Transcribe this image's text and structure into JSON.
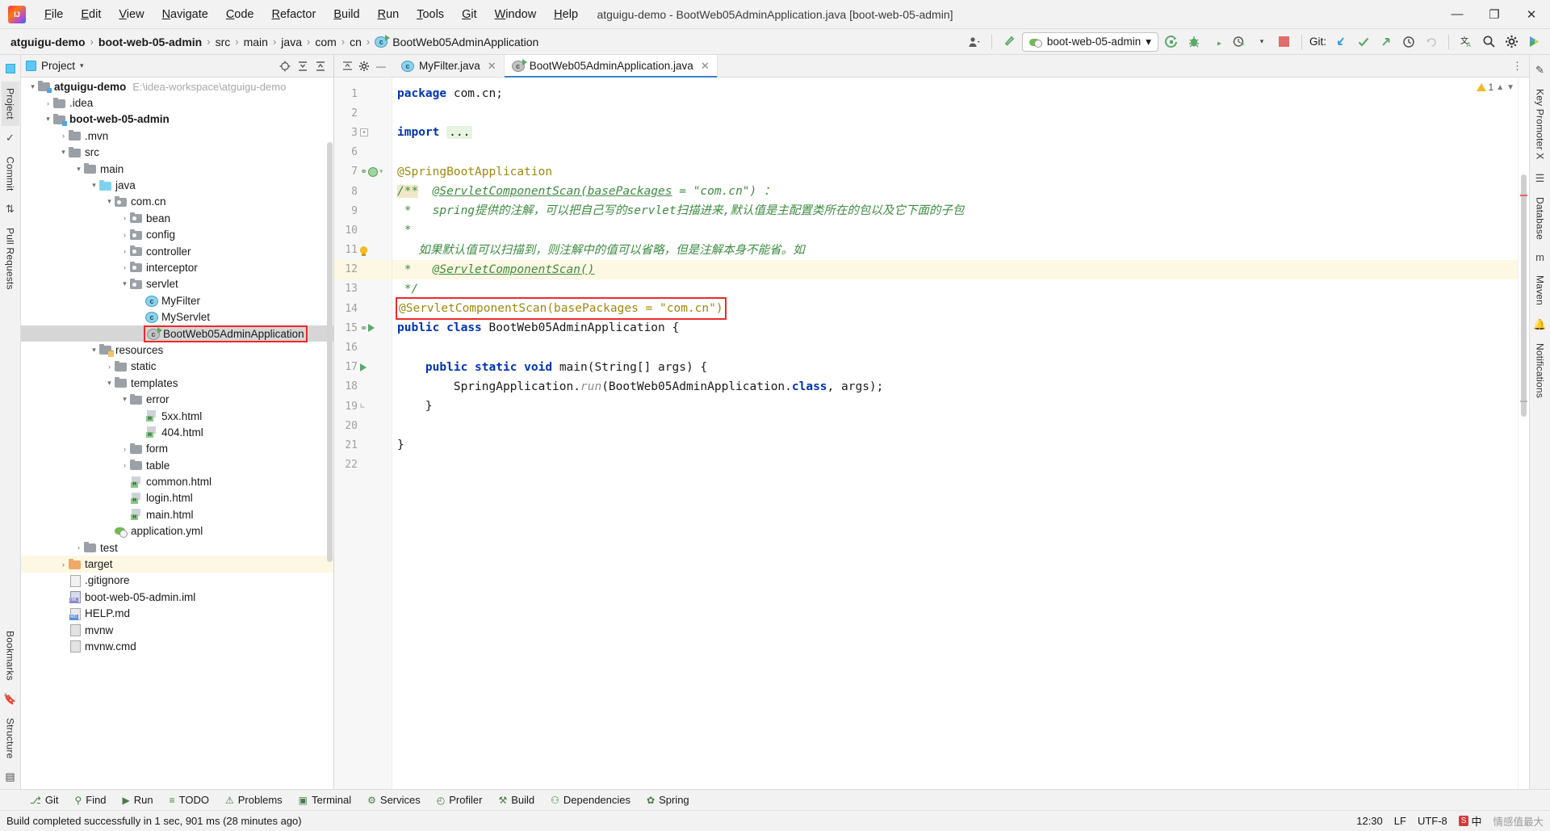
{
  "window": {
    "title": "atguigu-demo - BootWeb05AdminApplication.java [boot-web-05-admin]",
    "minimize": "—",
    "maximize": "❐",
    "close": "✕"
  },
  "menubar": {
    "items": [
      "File",
      "Edit",
      "View",
      "Navigate",
      "Code",
      "Refactor",
      "Build",
      "Run",
      "Tools",
      "Git",
      "Window",
      "Help"
    ]
  },
  "breadcrumb": {
    "items": [
      {
        "label": "atguigu-demo",
        "bold": true
      },
      {
        "label": "boot-web-05-admin",
        "bold": true
      },
      {
        "label": "src",
        "bold": false
      },
      {
        "label": "main",
        "bold": false
      },
      {
        "label": "java",
        "bold": false
      },
      {
        "label": "com",
        "bold": false
      },
      {
        "label": "cn",
        "bold": false
      },
      {
        "label": "BootWeb05AdminApplication",
        "bold": false,
        "icon": "java-class-icon"
      }
    ],
    "separator": "›"
  },
  "toolbar": {
    "run_config": "boot-web-05-admin",
    "run_config_caret": "▾",
    "icons": [
      {
        "name": "user-avatar-icon",
        "glyph": "♟"
      },
      {
        "name": "build-hammer-icon",
        "glyph": "⚒"
      },
      {
        "name": "run-icon",
        "glyph": "➤"
      },
      {
        "name": "debug-icon",
        "glyph": "☢"
      },
      {
        "name": "run-with-coverage-icon",
        "glyph": "◐"
      },
      {
        "name": "profiler-icon",
        "glyph": "◴"
      },
      {
        "name": "stop-icon",
        "glyph": "■"
      }
    ],
    "git_label": "Git:",
    "git_icons": [
      {
        "name": "git-update-project-icon",
        "glyph": "↙"
      },
      {
        "name": "git-commit-icon",
        "glyph": "✓"
      },
      {
        "name": "git-push-icon",
        "glyph": "↗"
      },
      {
        "name": "git-history-icon",
        "glyph": "◷"
      },
      {
        "name": "git-rollback-icon",
        "glyph": "↶"
      }
    ],
    "right_icons": [
      {
        "name": "translate-icon",
        "glyph": "文"
      },
      {
        "name": "search-everywhere-icon",
        "glyph": "⚲"
      },
      {
        "name": "settings-gear-icon",
        "glyph": "⚙"
      },
      {
        "name": "ide-features-trainer-icon",
        "glyph": "◕"
      }
    ]
  },
  "left_rail": {
    "items": [
      {
        "label": "Project",
        "active": true,
        "name": "rail-project"
      },
      {
        "label": "Commit",
        "active": false,
        "name": "rail-commit"
      },
      {
        "label": "Pull Requests",
        "active": false,
        "name": "rail-pull-requests"
      },
      {
        "label": "Bookmarks",
        "active": false,
        "name": "rail-bookmarks"
      },
      {
        "label": "Structure",
        "active": false,
        "name": "rail-structure"
      }
    ]
  },
  "right_rail": {
    "items": [
      {
        "label": "Key Promoter X",
        "name": "rail-key-promoter"
      },
      {
        "label": "Database",
        "name": "rail-database"
      },
      {
        "label": "Maven",
        "name": "rail-maven"
      },
      {
        "label": "Notifications",
        "name": "rail-notifications"
      }
    ]
  },
  "project_panel": {
    "title": "Project",
    "dropdown_caret": "▾",
    "actions": [
      {
        "name": "select-opened-file-icon",
        "glyph": "⊕"
      },
      {
        "name": "expand-all-icon",
        "glyph": "⨅"
      },
      {
        "name": "collapse-all-icon",
        "glyph": "⨄"
      },
      {
        "name": "settings-gear-icon",
        "glyph": "⚙"
      },
      {
        "name": "hide-panel-icon",
        "glyph": "—"
      }
    ],
    "tree": [
      {
        "label": "atguigu-demo",
        "path": "E:\\idea-workspace\\atguigu-demo",
        "indent": 0,
        "arrow": "v",
        "icon": "module-folder",
        "bold": true
      },
      {
        "label": ".idea",
        "indent": 1,
        "arrow": ">",
        "icon": "folder"
      },
      {
        "label": "boot-web-05-admin",
        "indent": 1,
        "arrow": "v",
        "icon": "module-folder",
        "bold": true
      },
      {
        "label": ".mvn",
        "indent": 2,
        "arrow": ">",
        "icon": "folder"
      },
      {
        "label": "src",
        "indent": 2,
        "arrow": "v",
        "icon": "folder"
      },
      {
        "label": "main",
        "indent": 3,
        "arrow": "v",
        "icon": "folder"
      },
      {
        "label": "java",
        "indent": 4,
        "arrow": "v",
        "icon": "source-folder"
      },
      {
        "label": "com.cn",
        "indent": 5,
        "arrow": "v",
        "icon": "package-folder"
      },
      {
        "label": "bean",
        "indent": 6,
        "arrow": ">",
        "icon": "package-folder"
      },
      {
        "label": "config",
        "indent": 6,
        "arrow": ">",
        "icon": "package-folder"
      },
      {
        "label": "controller",
        "indent": 6,
        "arrow": ">",
        "icon": "package-folder"
      },
      {
        "label": "interceptor",
        "indent": 6,
        "arrow": ">",
        "icon": "package-folder"
      },
      {
        "label": "servlet",
        "indent": 6,
        "arrow": "v",
        "icon": "package-folder"
      },
      {
        "label": "MyFilter",
        "indent": 7,
        "arrow": "",
        "icon": "java-class"
      },
      {
        "label": "MyServlet",
        "indent": 7,
        "arrow": "",
        "icon": "java-class"
      },
      {
        "label": "BootWeb05AdminApplication",
        "indent": 7,
        "arrow": "",
        "icon": "spring-boot-class",
        "selected": true,
        "boxed": true
      },
      {
        "label": "resources",
        "indent": 4,
        "arrow": "v",
        "icon": "resource-folder"
      },
      {
        "label": "static",
        "indent": 5,
        "arrow": ">",
        "icon": "folder"
      },
      {
        "label": "templates",
        "indent": 5,
        "arrow": "v",
        "icon": "folder"
      },
      {
        "label": "error",
        "indent": 6,
        "arrow": "v",
        "icon": "folder"
      },
      {
        "label": "5xx.html",
        "indent": 7,
        "arrow": "",
        "icon": "html-file"
      },
      {
        "label": "404.html",
        "indent": 7,
        "arrow": "",
        "icon": "html-file"
      },
      {
        "label": "form",
        "indent": 6,
        "arrow": ">",
        "icon": "folder"
      },
      {
        "label": "table",
        "indent": 6,
        "arrow": ">",
        "icon": "folder"
      },
      {
        "label": "common.html",
        "indent": 6,
        "arrow": "",
        "icon": "html-file"
      },
      {
        "label": "login.html",
        "indent": 6,
        "arrow": "",
        "icon": "html-file"
      },
      {
        "label": "main.html",
        "indent": 6,
        "arrow": "",
        "icon": "html-file"
      },
      {
        "label": "application.yml",
        "indent": 5,
        "arrow": "",
        "icon": "spring-yaml-file"
      },
      {
        "label": "test",
        "indent": 3,
        "arrow": ">",
        "icon": "folder"
      },
      {
        "label": "target",
        "indent": 2,
        "arrow": ">",
        "icon": "excluded-folder",
        "highlight": true
      },
      {
        "label": ".gitignore",
        "indent": 2,
        "arrow": "",
        "icon": "git-file"
      },
      {
        "label": "boot-web-05-admin.iml",
        "indent": 2,
        "arrow": "",
        "icon": "iml-file"
      },
      {
        "label": "HELP.md",
        "indent": 2,
        "arrow": "",
        "icon": "md-file"
      },
      {
        "label": "mvnw",
        "indent": 2,
        "arrow": "",
        "icon": "file"
      },
      {
        "label": "mvnw.cmd",
        "indent": 2,
        "arrow": "",
        "icon": "file"
      }
    ]
  },
  "editor": {
    "tabs": [
      {
        "label": "MyFilter.java",
        "icon": "java-class-icon",
        "active": false,
        "close": "✕"
      },
      {
        "label": "BootWeb05AdminApplication.java",
        "icon": "spring-boot-class-icon",
        "active": true,
        "close": "✕"
      }
    ],
    "tab_actions": [
      {
        "name": "settings-gear-icon",
        "glyph": "⚙"
      },
      {
        "name": "hide-icon",
        "glyph": "—"
      }
    ],
    "more_icon": "⋮",
    "warning_count": "1",
    "warning_nav_up": "⌃",
    "warning_nav_down": "⌄",
    "lines": [
      {
        "num": "1",
        "segments": [
          {
            "t": "package",
            "c": "kw"
          },
          {
            "t": " com.cn;",
            "c": "plain"
          }
        ]
      },
      {
        "num": "2",
        "segments": []
      },
      {
        "num": "3",
        "segments": [
          {
            "t": "import",
            "c": "kw"
          },
          {
            "t": " ",
            "c": "plain"
          },
          {
            "t": "...",
            "c": "importfold"
          }
        ],
        "fold": true
      },
      {
        "num": "6",
        "segments": []
      },
      {
        "num": "7",
        "segments": [
          {
            "t": "@SpringBootApplication",
            "c": "anno"
          }
        ],
        "marks": [
          "bean-icon",
          "spring-icon"
        ],
        "foldmark": true
      },
      {
        "num": "8",
        "segments": [
          {
            "t": "/**",
            "c": "doctag"
          },
          {
            "t": "  ",
            "c": "plain"
          },
          {
            "t": "@ServletComponentScan(basePackages",
            "c": "doc-ul"
          },
          {
            "t": " = ",
            "c": "doc"
          },
          {
            "t": "\"com.cn\")",
            "c": "doc"
          },
          {
            "t": " ：",
            "c": "doc"
          }
        ]
      },
      {
        "num": "9",
        "segments": [
          {
            "t": " *   ",
            "c": "doc"
          },
          {
            "t": "spring提供的注解，可以把自己写的servlet扫描进来,默认值是主配置类所在的包以及它下面的子包",
            "c": "doc"
          }
        ]
      },
      {
        "num": "10",
        "segments": [
          {
            "t": " *",
            "c": "doc"
          }
        ]
      },
      {
        "num": "11",
        "segments": [
          {
            "t": "   如果默认值可以扫描到，则注解中的值可以省略，但是注解本身不能省。如",
            "c": "doc"
          }
        ],
        "marks": [
          "bulb-icon"
        ]
      },
      {
        "num": "12",
        "segments": [
          {
            "t": " *   ",
            "c": "doc"
          },
          {
            "t": "@ServletComponentScan()",
            "c": "doc-ul"
          }
        ],
        "current": true
      },
      {
        "num": "13",
        "segments": [
          {
            "t": " */",
            "c": "doc"
          }
        ]
      },
      {
        "num": "14",
        "segments": [
          {
            "t": "@ServletComponentScan(basePackages = \"com.cn\")",
            "c": "anno",
            "boxed": true
          }
        ]
      },
      {
        "num": "15",
        "segments": [
          {
            "t": "public",
            "c": "kw"
          },
          {
            "t": " ",
            "c": "plain"
          },
          {
            "t": "class",
            "c": "kw"
          },
          {
            "t": " BootWeb05AdminApplication {",
            "c": "plain"
          }
        ],
        "marks": [
          "bean-icon",
          "run-icon"
        ]
      },
      {
        "num": "16",
        "segments": []
      },
      {
        "num": "17",
        "segments": [
          {
            "t": "    ",
            "c": "plain"
          },
          {
            "t": "public",
            "c": "kw"
          },
          {
            "t": " ",
            "c": "plain"
          },
          {
            "t": "static",
            "c": "kw"
          },
          {
            "t": " ",
            "c": "plain"
          },
          {
            "t": "void",
            "c": "kw"
          },
          {
            "t": " ",
            "c": "plain"
          },
          {
            "t": "main",
            "c": "plain"
          },
          {
            "t": "(String[] args) {",
            "c": "plain"
          }
        ],
        "marks": [
          "run-icon"
        ]
      },
      {
        "num": "18",
        "segments": [
          {
            "t": "        SpringApplication.",
            "c": "plain"
          },
          {
            "t": "run",
            "c": "cmt"
          },
          {
            "t": "(BootWeb05AdminApplication.",
            "c": "plain"
          },
          {
            "t": "class",
            "c": "kw"
          },
          {
            "t": ", args);",
            "c": "plain"
          }
        ]
      },
      {
        "num": "19",
        "segments": [
          {
            "t": "    }",
            "c": "plain"
          }
        ],
        "foldend": true
      },
      {
        "num": "20",
        "segments": []
      },
      {
        "num": "21",
        "segments": [
          {
            "t": "}",
            "c": "plain"
          }
        ]
      },
      {
        "num": "22",
        "segments": []
      }
    ]
  },
  "bottom_tools": [
    {
      "label": "Git",
      "icon": "git-icon",
      "glyph": "⎇",
      "name": "tool-git"
    },
    {
      "label": "Find",
      "icon": "find-icon",
      "glyph": "⚲",
      "name": "tool-find"
    },
    {
      "label": "Run",
      "icon": "run-icon",
      "glyph": "▶",
      "name": "tool-run"
    },
    {
      "label": "TODO",
      "icon": "todo-icon",
      "glyph": "≡",
      "name": "tool-todo"
    },
    {
      "label": "Problems",
      "icon": "problems-icon",
      "glyph": "⚠",
      "name": "tool-problems"
    },
    {
      "label": "Terminal",
      "icon": "terminal-icon",
      "glyph": "▣",
      "name": "tool-terminal"
    },
    {
      "label": "Services",
      "icon": "services-icon",
      "glyph": "⚙",
      "name": "tool-services"
    },
    {
      "label": "Profiler",
      "icon": "profiler-icon",
      "glyph": "◴",
      "name": "tool-profiler"
    },
    {
      "label": "Build",
      "icon": "build-icon",
      "glyph": "⚒",
      "name": "tool-build"
    },
    {
      "label": "Dependencies",
      "icon": "dependencies-icon",
      "glyph": "⚇",
      "name": "tool-dependencies"
    },
    {
      "label": "Spring",
      "icon": "spring-icon",
      "glyph": "✿",
      "name": "tool-spring"
    }
  ],
  "statusbar": {
    "message": "Build completed successfully in 1 sec, 901 ms (28 minutes ago)",
    "time": "12:30",
    "line_separator": "LF",
    "encoding": "UTF-8",
    "ime_label": "中",
    "ime_badge": "S",
    "watermark": "情感值最大"
  }
}
